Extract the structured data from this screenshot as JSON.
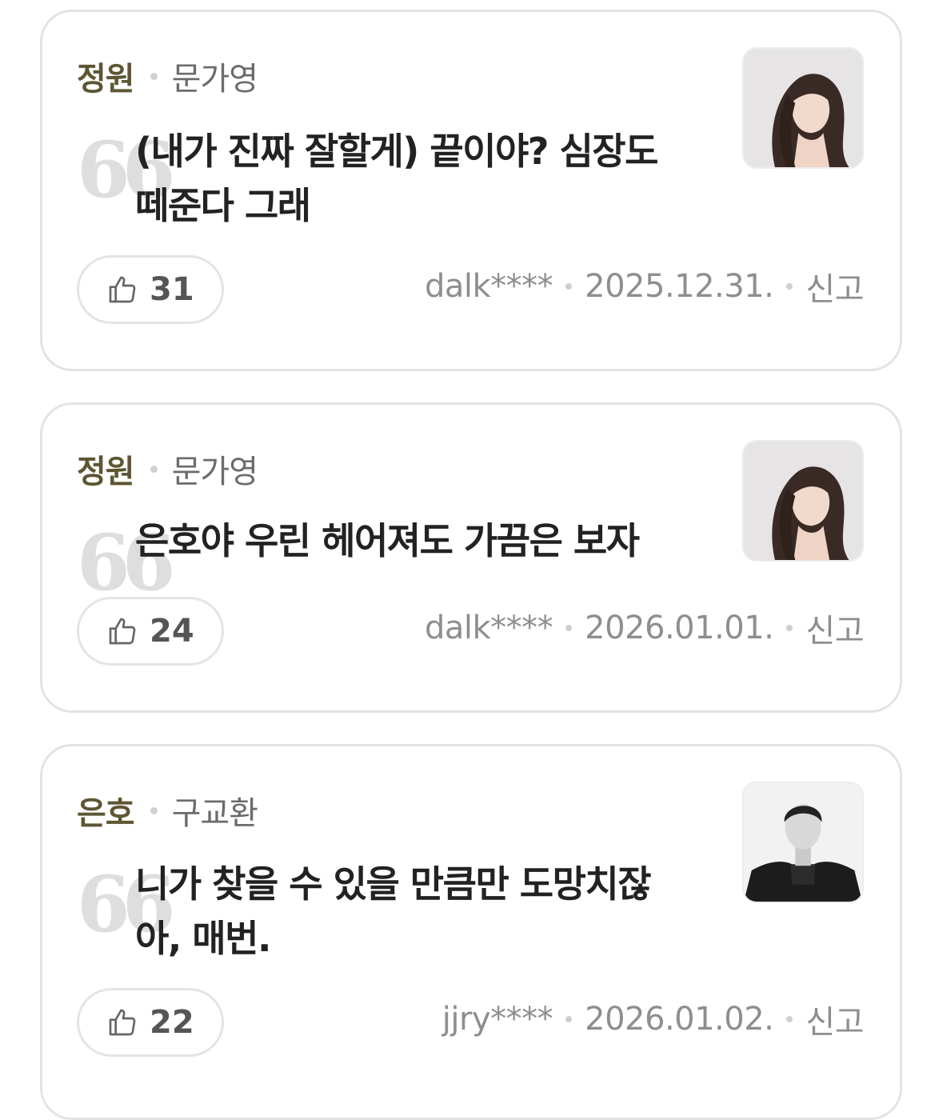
{
  "comments": [
    {
      "role": "정원",
      "actor": "문가영",
      "quote_mark": "66",
      "text_line1": "(내가 진짜 잘할게) 끝이야? 심장도",
      "text_line2": "떼준다 그래",
      "likes": "31",
      "user": "dalk****",
      "date": "2025.12.31.",
      "report": "신고"
    },
    {
      "role": "정원",
      "actor": "문가영",
      "quote_mark": "66",
      "text_line1": "은호야 우린 헤어져도 가끔은 보자",
      "text_line2": "",
      "likes": "24",
      "user": "dalk****",
      "date": "2026.01.01.",
      "report": "신고"
    },
    {
      "role": "은호",
      "actor": "구교환",
      "quote_mark": "66",
      "text_line1": "니가 찾을 수 있을 만큼만 도망치잖",
      "text_line2": "아, 매번.",
      "likes": "22",
      "user": "jjry****",
      "date": "2026.01.02.",
      "report": "신고"
    }
  ],
  "colors": {
    "role": "#5e5632",
    "text": "#222222",
    "meta": "#8e8e8e",
    "border": "#e3e3e3"
  }
}
